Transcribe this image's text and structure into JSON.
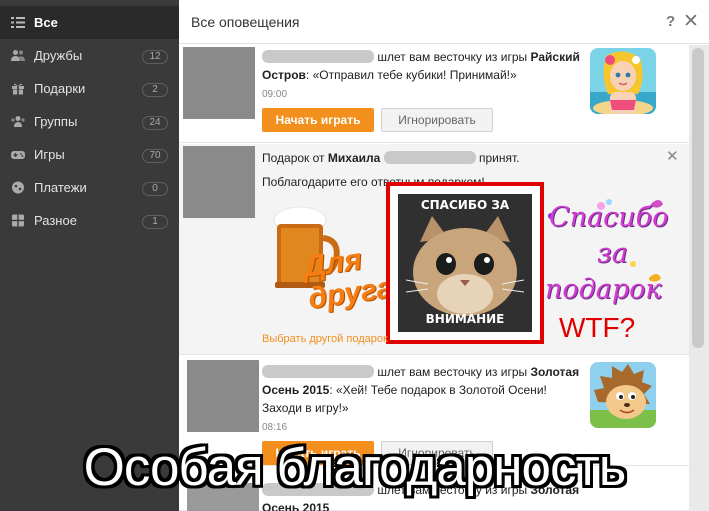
{
  "sidebar": {
    "items": [
      {
        "label": "Все",
        "count": ""
      },
      {
        "label": "Дружбы",
        "count": "12"
      },
      {
        "label": "Подарки",
        "count": "2"
      },
      {
        "label": "Группы",
        "count": "24"
      },
      {
        "label": "Игры",
        "count": "70"
      },
      {
        "label": "Платежи",
        "count": "0"
      },
      {
        "label": "Разное",
        "count": "1"
      }
    ]
  },
  "header": {
    "title": "Все оповещения",
    "help": "?",
    "close": "✕"
  },
  "notifications": [
    {
      "text_prefix": "шлет вам весточку из игры",
      "game": "Райский Остров",
      "message": ": «Отправил тебе кубики! Принимай!»",
      "time": "09:00",
      "play_label": "Начать играть",
      "ignore_label": "Игнорировать"
    },
    {
      "text_prefix": "Подарок от",
      "sender": "Михаила",
      "text_suffix": "принят.",
      "thanks_text": "Поблагодарите его ответным подарком!",
      "choose_label": "Выбрать другой подарок",
      "close": "✕",
      "stickers": {
        "beer": "Для друга",
        "cat_top": "СПАСИБО ЗА",
        "cat_bottom": "ВНИМАНИЕ",
        "thanks_line1": "Спасибо",
        "thanks_line2": "за",
        "thanks_line3": "подарок",
        "wtf": "WTF?"
      }
    },
    {
      "text_prefix": "шлет вам весточку из игры",
      "game": "Золотая Осень 2015",
      "message": ": «Хей! Тебе подарок в Золотой Осени! Заходи в игру!»",
      "time": "08:16",
      "play_label": "Начать играть",
      "ignore_label": "Игнорировать"
    },
    {
      "text_prefix": "шлет вам весточку из игры",
      "game": "Золотая Осень 2015"
    }
  ],
  "caption": "Особая благодарность",
  "colors": {
    "accent": "#f28f1d",
    "sidebar": "#3a3a3a",
    "highlight": "#e00000"
  }
}
